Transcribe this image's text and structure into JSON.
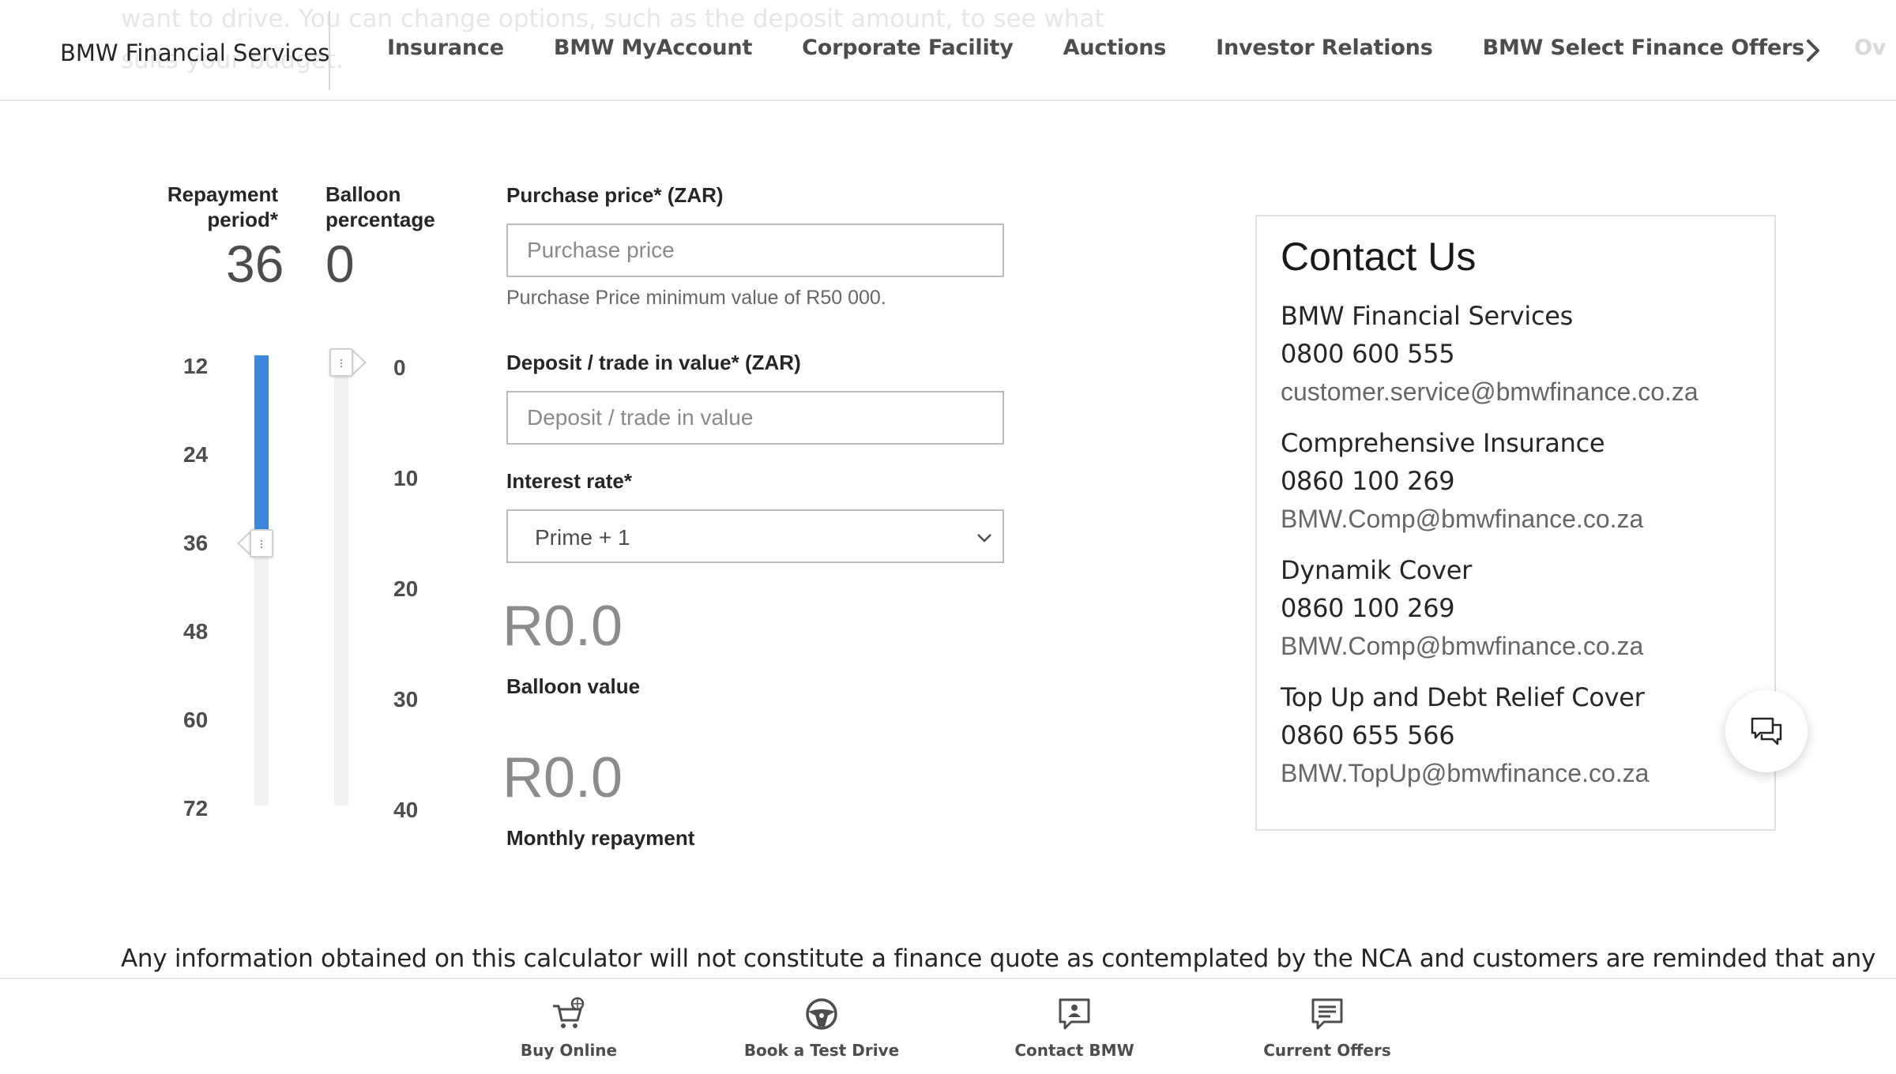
{
  "header": {
    "background_text_line1": "want to drive. You can change options, such as the deposit amount, to see what",
    "background_text_line2": "suits your budget.",
    "brand": "BMW Financial Services",
    "nav": [
      "Insurance",
      "BMW MyAccount",
      "Corporate Facility",
      "Auctions",
      "Investor Relations",
      "BMW Select Finance Offers",
      "Ov"
    ]
  },
  "sliders": {
    "repayment": {
      "label_line1": "Repayment",
      "label_line2": "period*",
      "value": "36",
      "ticks": [
        "12",
        "24",
        "36",
        "48",
        "60",
        "72"
      ],
      "fill_color": "#3c87dc"
    },
    "balloon": {
      "label_line1": "Balloon",
      "label_line2": "percentage",
      "value": "0",
      "ticks": [
        "0",
        "10",
        "20",
        "30",
        "40"
      ]
    }
  },
  "form": {
    "purchase_price_label": "Purchase price* (ZAR)",
    "purchase_price_placeholder": "Purchase price",
    "purchase_price_value": "",
    "purchase_price_hint": "Purchase Price minimum value of R50 000.",
    "deposit_label": "Deposit / trade in value* (ZAR)",
    "deposit_placeholder": "Deposit / trade in value",
    "deposit_value": "",
    "interest_label": "Interest rate*",
    "interest_selected": "Prime + 1"
  },
  "results": {
    "balloon_value": "R0.0",
    "balloon_label": "Balloon value",
    "monthly_value": "R0.0",
    "monthly_label": "Monthly repayment"
  },
  "contact": {
    "title": "Contact Us",
    "groups": [
      {
        "name": "BMW Financial Services",
        "phone": "0800 600 555",
        "email": "customer.service@bmwfinance.co.za"
      },
      {
        "name": "Comprehensive Insurance",
        "phone": "0860 100 269",
        "email": "BMW.Comp@bmwfinance.co.za"
      },
      {
        "name": "Dynamik Cover",
        "phone": "0860 100 269",
        "email": "BMW.Comp@bmwfinance.co.za"
      },
      {
        "name": "Top Up and Debt Relief Cover",
        "phone": "0860 655 566",
        "email": "BMW.TopUp@bmwfinance.co.za"
      }
    ]
  },
  "disclaimer": "Any information obtained on this calculator will not constitute a finance quote as contemplated by the NCA and customers are reminded that any",
  "bottom_bar": [
    {
      "label": "Buy Online",
      "icon": "cart-icon"
    },
    {
      "label": "Book a Test Drive",
      "icon": "steering-wheel-icon"
    },
    {
      "label": "Contact BMW",
      "icon": "contact-chat-icon"
    },
    {
      "label": "Current Offers",
      "icon": "offers-chat-icon"
    }
  ]
}
